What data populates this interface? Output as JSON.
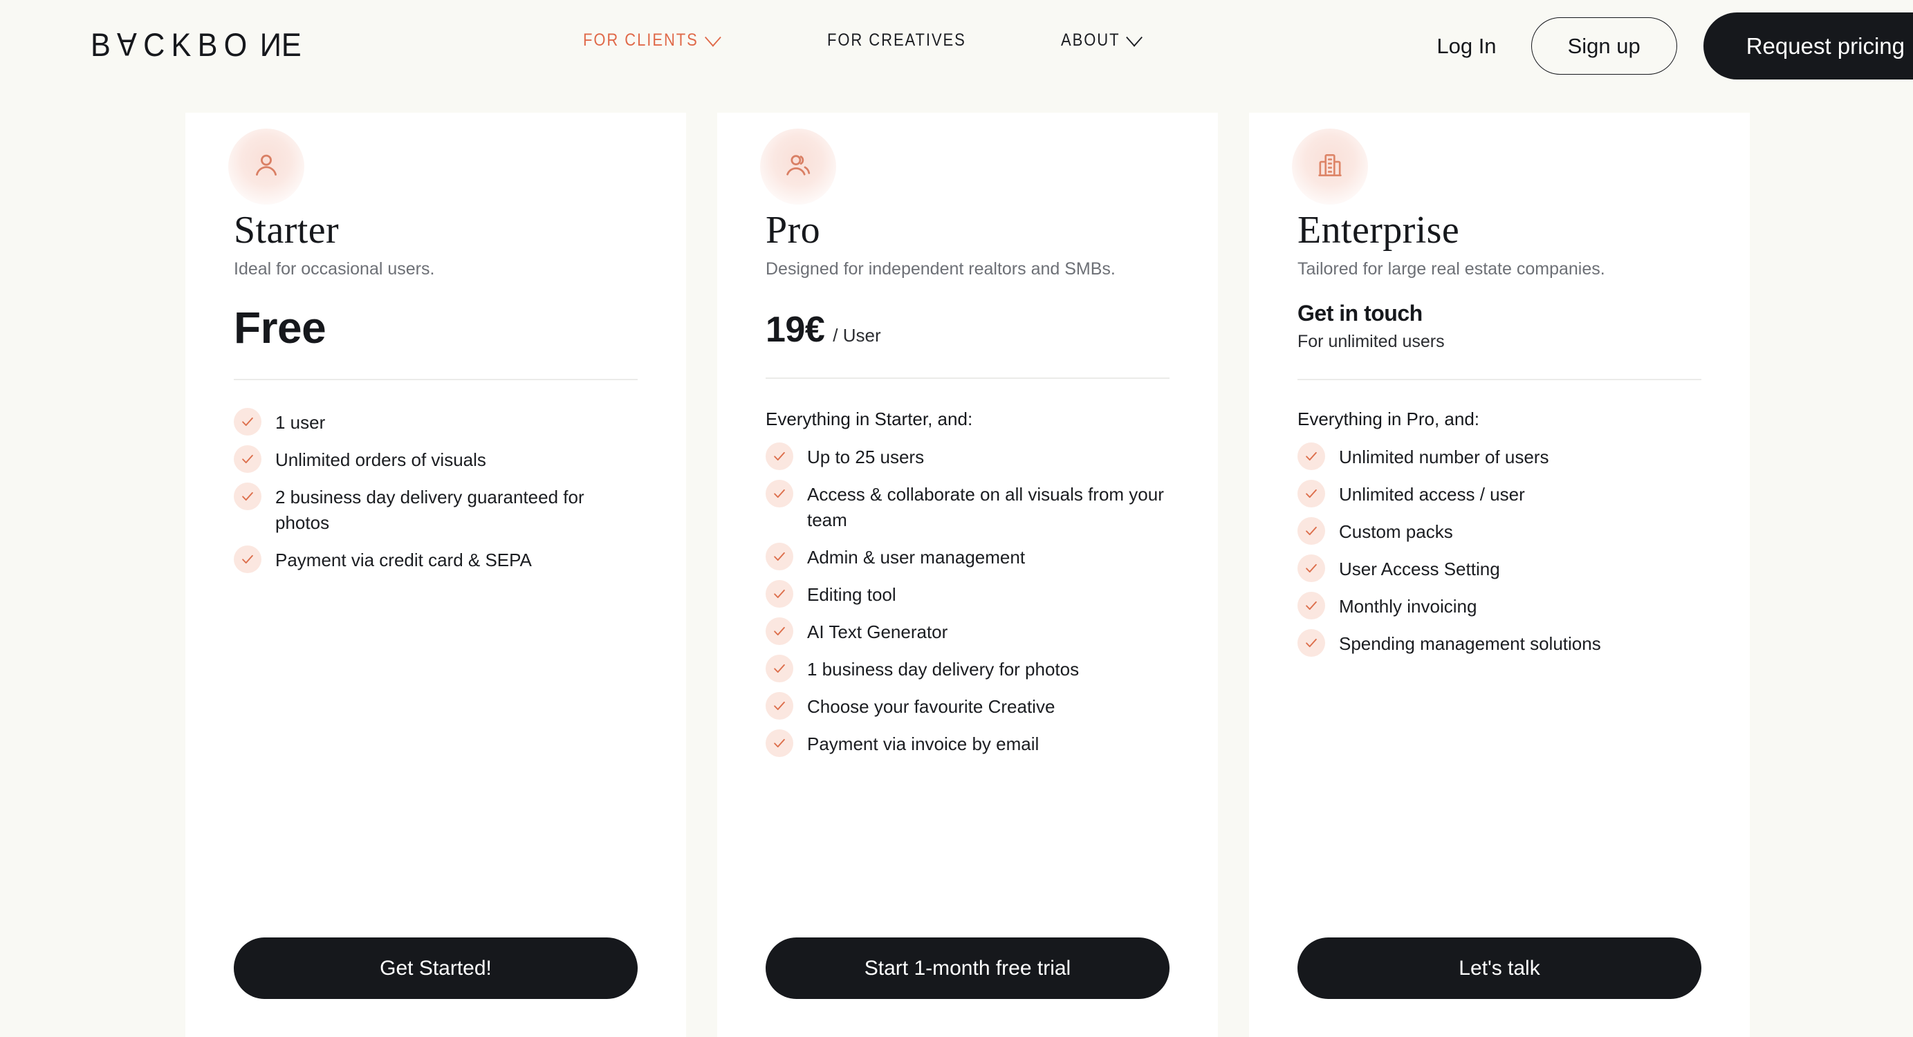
{
  "colors": {
    "page_bg": "#f9f9f4",
    "card_bg": "#ffffff",
    "accent": "#e06a4a",
    "dark": "#16181c",
    "check_bg": "#fbe7e0",
    "muted_text": "#6d7076",
    "divider": "#ebebe9"
  },
  "header": {
    "logo_text": "BACKBONE",
    "logo_letters": [
      "B",
      "A",
      "C",
      "K",
      "B",
      "O",
      "N",
      "E"
    ],
    "nav": [
      {
        "label": "FOR CLIENTS",
        "active": true,
        "has_chevron": true
      },
      {
        "label": "FOR CREATIVES",
        "active": false,
        "has_chevron": false
      },
      {
        "label": "ABOUT",
        "active": false,
        "has_chevron": true
      }
    ],
    "login_label": "Log In",
    "signup_label": "Sign up",
    "request_pricing_label": "Request pricing"
  },
  "plans": [
    {
      "icon": "person-icon",
      "name": "Starter",
      "tagline": "Ideal for occasional users.",
      "price_main": "Free",
      "price_unit": "",
      "price_sub": "",
      "features_title": "",
      "features": [
        "1 user",
        "Unlimited orders of visuals",
        "2 business day delivery guaranteed for photos",
        "Payment via credit card & SEPA"
      ],
      "cta_label": "Get Started!"
    },
    {
      "icon": "people-icon",
      "name": "Pro",
      "tagline": "Designed for independent realtors and SMBs.",
      "price_main": "19€",
      "price_unit": "/ User",
      "price_sub": "",
      "features_title": "Everything in Starter, and:",
      "features": [
        "Up to 25 users",
        "Access & collaborate on all visuals from your team",
        "Admin & user management",
        "Editing tool",
        "AI Text Generator",
        "1 business day delivery for photos",
        "Choose your favourite Creative",
        "Payment via invoice by email"
      ],
      "cta_label": "Start 1-month free trial"
    },
    {
      "icon": "building-icon",
      "name": "Enterprise",
      "tagline": "Tailored for large real estate companies.",
      "price_main": "Get in touch",
      "price_unit": "",
      "price_sub": "For unlimited users",
      "features_title": "Everything in Pro, and:",
      "features": [
        "Unlimited number of users",
        "Unlimited access / user",
        "Custom packs",
        "User Access Setting",
        "Monthly invoicing",
        "Spending management solutions"
      ],
      "cta_label": "Let's talk"
    }
  ]
}
